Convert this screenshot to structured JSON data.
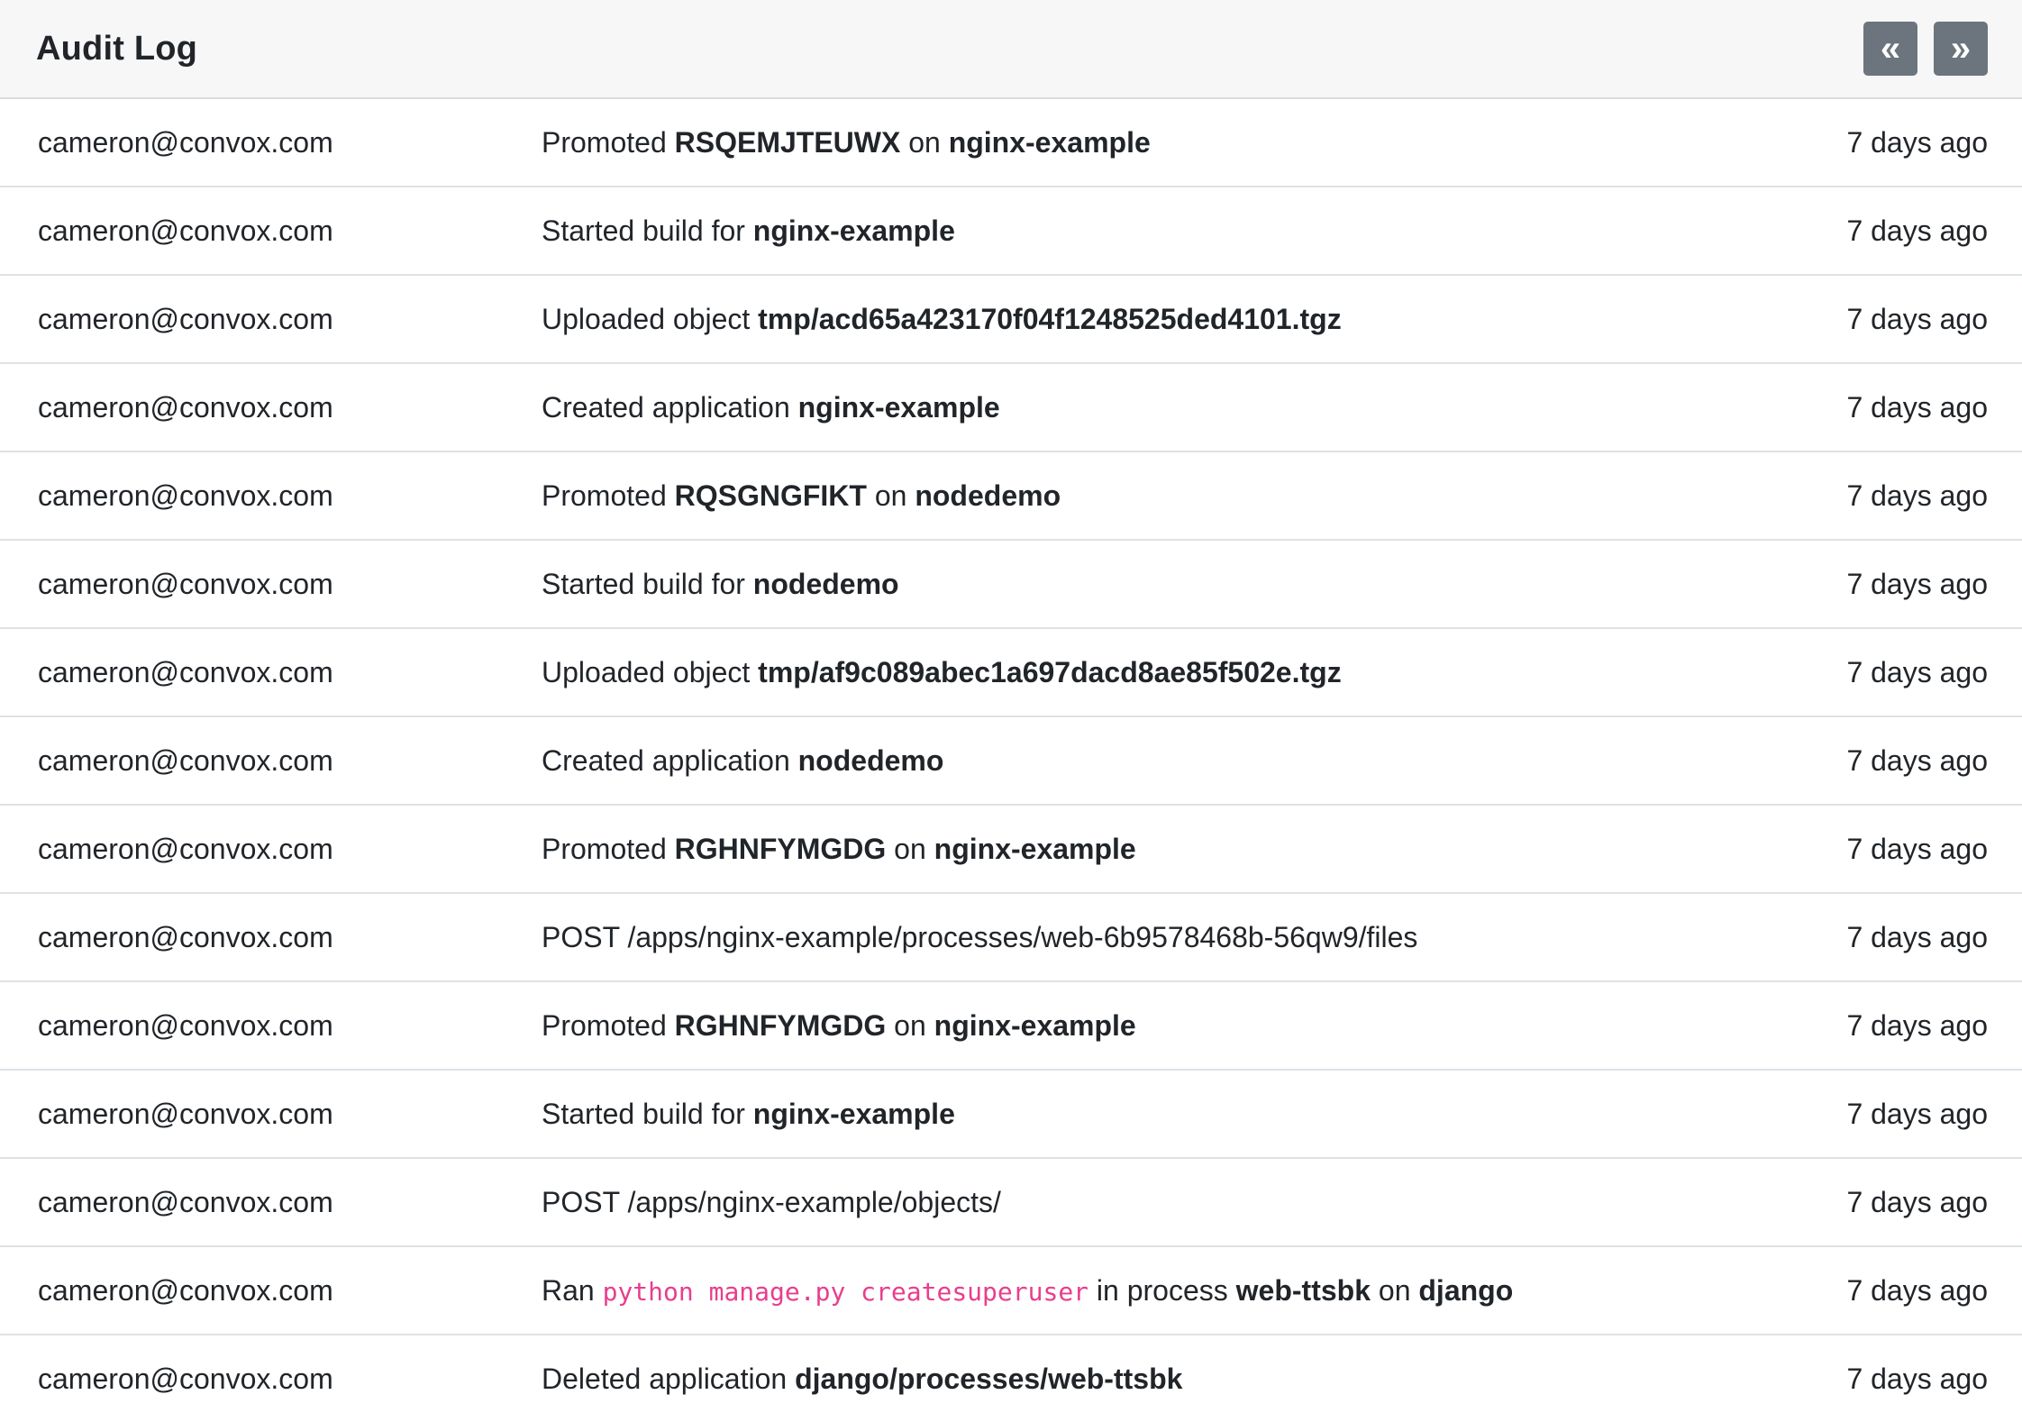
{
  "header": {
    "title": "Audit Log",
    "prev_icon": "«",
    "next_icon": "»"
  },
  "entries": [
    {
      "user": "cameron@convox.com",
      "parts": [
        {
          "t": "Promoted "
        },
        {
          "t": "RSQEMJTEUWX",
          "b": 1
        },
        {
          "t": " on "
        },
        {
          "t": "nginx-example",
          "b": 1
        }
      ],
      "time": "7 days ago"
    },
    {
      "user": "cameron@convox.com",
      "parts": [
        {
          "t": "Started build for "
        },
        {
          "t": "nginx-example",
          "b": 1
        }
      ],
      "time": "7 days ago"
    },
    {
      "user": "cameron@convox.com",
      "parts": [
        {
          "t": "Uploaded object "
        },
        {
          "t": "tmp/acd65a423170f04f1248525ded4101.tgz",
          "b": 1
        }
      ],
      "time": "7 days ago"
    },
    {
      "user": "cameron@convox.com",
      "parts": [
        {
          "t": "Created application "
        },
        {
          "t": "nginx-example",
          "b": 1
        }
      ],
      "time": "7 days ago"
    },
    {
      "user": "cameron@convox.com",
      "parts": [
        {
          "t": "Promoted "
        },
        {
          "t": "RQSGNGFIKT",
          "b": 1
        },
        {
          "t": " on "
        },
        {
          "t": "nodedemo",
          "b": 1
        }
      ],
      "time": "7 days ago"
    },
    {
      "user": "cameron@convox.com",
      "parts": [
        {
          "t": "Started build for "
        },
        {
          "t": "nodedemo",
          "b": 1
        }
      ],
      "time": "7 days ago"
    },
    {
      "user": "cameron@convox.com",
      "parts": [
        {
          "t": "Uploaded object "
        },
        {
          "t": "tmp/af9c089abec1a697dacd8ae85f502e.tgz",
          "b": 1
        }
      ],
      "time": "7 days ago"
    },
    {
      "user": "cameron@convox.com",
      "parts": [
        {
          "t": "Created application "
        },
        {
          "t": "nodedemo",
          "b": 1
        }
      ],
      "time": "7 days ago"
    },
    {
      "user": "cameron@convox.com",
      "parts": [
        {
          "t": "Promoted "
        },
        {
          "t": "RGHNFYMGDG",
          "b": 1
        },
        {
          "t": " on "
        },
        {
          "t": "nginx-example",
          "b": 1
        }
      ],
      "time": "7 days ago"
    },
    {
      "user": "cameron@convox.com",
      "parts": [
        {
          "t": "POST /apps/nginx-example/processes/web-6b9578468b-56qw9/files"
        }
      ],
      "time": "7 days ago"
    },
    {
      "user": "cameron@convox.com",
      "parts": [
        {
          "t": "Promoted "
        },
        {
          "t": "RGHNFYMGDG",
          "b": 1
        },
        {
          "t": " on "
        },
        {
          "t": "nginx-example",
          "b": 1
        }
      ],
      "time": "7 days ago"
    },
    {
      "user": "cameron@convox.com",
      "parts": [
        {
          "t": "Started build for "
        },
        {
          "t": "nginx-example",
          "b": 1
        }
      ],
      "time": "7 days ago"
    },
    {
      "user": "cameron@convox.com",
      "parts": [
        {
          "t": "POST /apps/nginx-example/objects/"
        }
      ],
      "time": "7 days ago"
    },
    {
      "user": "cameron@convox.com",
      "parts": [
        {
          "t": "Ran "
        },
        {
          "t": "python manage.py createsuperuser",
          "c": 1
        },
        {
          "t": " in process "
        },
        {
          "t": "web-ttsbk",
          "b": 1
        },
        {
          "t": " on "
        },
        {
          "t": "django",
          "b": 1
        }
      ],
      "time": "7 days ago"
    },
    {
      "user": "cameron@convox.com",
      "parts": [
        {
          "t": "Deleted application "
        },
        {
          "t": "django/processes/web-ttsbk",
          "b": 1
        }
      ],
      "time": "7 days ago"
    }
  ]
}
